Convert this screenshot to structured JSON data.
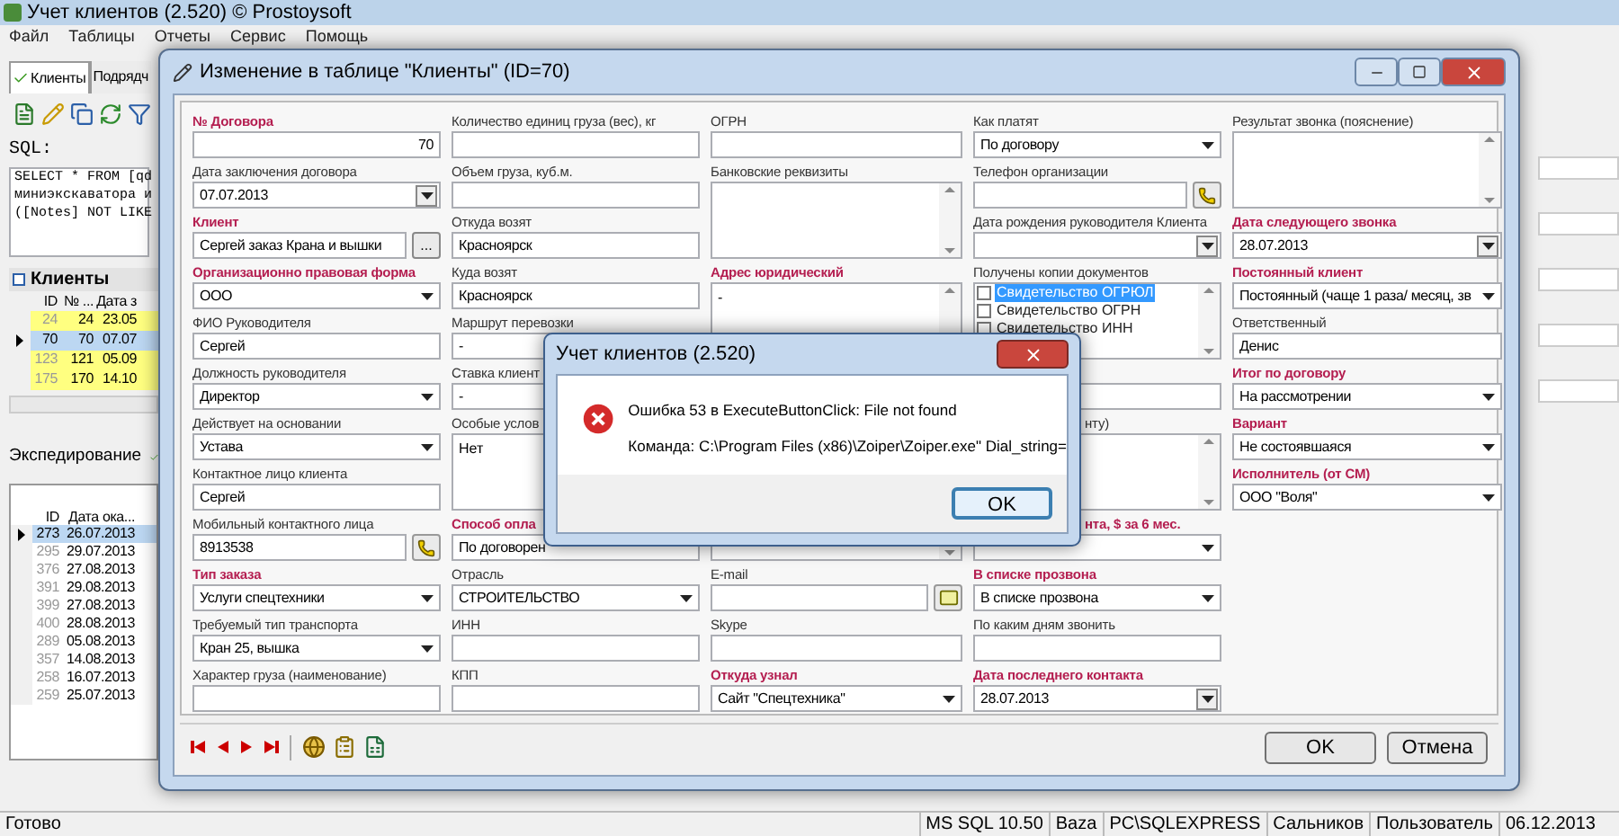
{
  "app": {
    "title": "Учет клиентов (2.520) © Prostoysoft",
    "menu": [
      "Файл",
      "Таблицы",
      "Отчеты",
      "Сервис",
      "Помощь"
    ],
    "tabs": [
      {
        "label": "Клиенты",
        "selected": true
      },
      {
        "label": "Подрядч",
        "selected": false
      }
    ],
    "sql_label": "SQL:",
    "sql_lines": [
      "SELECT * FROM [qd",
      "миниэкскаватора и",
      "([Notes] NOT LIKE"
    ],
    "clients": {
      "title": "Клиенты",
      "columns": [
        "ID",
        "№ ...",
        "Дата з"
      ],
      "rows": [
        {
          "cells": [
            "24",
            "24",
            "23.05"
          ],
          "selected": false,
          "highlighted": true
        },
        {
          "cells": [
            "70",
            "70",
            "07.07"
          ],
          "selected": true,
          "highlighted": false
        },
        {
          "cells": [
            "123",
            "121",
            "05.09"
          ],
          "selected": false,
          "highlighted": true
        },
        {
          "cells": [
            "175",
            "170",
            "14.10"
          ],
          "selected": false,
          "highlighted": true
        }
      ]
    },
    "expedition": {
      "title": "Экспедирование",
      "columns": [
        "ID",
        "Дата ока..."
      ],
      "rows": [
        {
          "cells": [
            "273",
            "26.07.2013"
          ],
          "selected": true
        },
        {
          "cells": [
            "295",
            "29.07.2013"
          ],
          "selected": false
        },
        {
          "cells": [
            "376",
            "27.08.2013"
          ],
          "selected": false
        },
        {
          "cells": [
            "391",
            "29.08.2013"
          ],
          "selected": false
        },
        {
          "cells": [
            "399",
            "27.08.2013"
          ],
          "selected": false
        },
        {
          "cells": [
            "400",
            "28.08.2013"
          ],
          "selected": false
        },
        {
          "cells": [
            "289",
            "05.08.2013"
          ],
          "selected": false
        },
        {
          "cells": [
            "357",
            "14.08.2013"
          ],
          "selected": false
        },
        {
          "cells": [
            "258",
            "16.07.2013"
          ],
          "selected": false
        },
        {
          "cells": [
            "259",
            "25.07.2013"
          ],
          "selected": false
        }
      ]
    }
  },
  "dialog": {
    "title": "Изменение в таблице \"Клиенты\" (ID=70)",
    "columns": [
      [
        {
          "label": "№ Договора",
          "required": true,
          "kind": "number",
          "value": "70"
        },
        {
          "label": "Дата заключения договора",
          "required": false,
          "kind": "date",
          "value": "07.07.2013"
        },
        {
          "label": "Клиент",
          "required": true,
          "kind": "browse",
          "value": "Сергей заказ Крана и вышки",
          "button_text": "..."
        },
        {
          "label": "Организационно правовая форма",
          "required": true,
          "kind": "select",
          "value": "ООО"
        },
        {
          "label": "ФИО Руководителя",
          "required": false,
          "kind": "text",
          "value": "Сергей"
        },
        {
          "label": "Должность руководителя",
          "required": false,
          "kind": "select",
          "value": "Директор"
        },
        {
          "label": "Действует на основании",
          "required": false,
          "kind": "select",
          "value": "Устава"
        },
        {
          "label": "Контактное лицо клиента",
          "required": false,
          "kind": "text",
          "value": "Сергей"
        },
        {
          "label": "Мобильный контактного лица",
          "required": false,
          "kind": "phone",
          "value": "8913538"
        },
        {
          "label": "Тип заказа",
          "required": true,
          "kind": "select",
          "value": "Услуги спецтехники"
        },
        {
          "label": "Требуемый тип транспорта",
          "required": false,
          "kind": "select",
          "value": "Кран 25, вышка"
        },
        {
          "label": "Характер груза (наименование)",
          "required": false,
          "kind": "text"
        }
      ],
      [
        {
          "label": "Количество единиц груза (вес), кг",
          "required": false,
          "kind": "text"
        },
        {
          "label": "Объем груза, куб.м.",
          "required": false,
          "kind": "text"
        },
        {
          "label": "Откуда возят",
          "required": false,
          "kind": "text",
          "value": "Красноярск"
        },
        {
          "label": "Куда возят",
          "required": false,
          "kind": "text",
          "value": "Красноярск"
        },
        {
          "label": "Маршрут перевозки",
          "required": false,
          "kind": "text",
          "value": "-"
        },
        {
          "label": "Ставка клиент",
          "required": false,
          "kind": "text",
          "value": "-"
        },
        {
          "label": "Особые услов",
          "required": false,
          "kind": "textarea",
          "value": "Нет"
        },
        {
          "label": "Способ опла",
          "required": true,
          "kind": "text",
          "value": "По договорен"
        },
        {
          "label": "Отрасль",
          "required": false,
          "kind": "select",
          "value": "СТРОИТЕЛЬСТВО"
        },
        {
          "label": "ИНН",
          "required": false,
          "kind": "text"
        },
        {
          "label": "КПП",
          "required": false,
          "kind": "text"
        }
      ],
      [
        {
          "label": "ОГРН",
          "required": false,
          "kind": "text"
        },
        {
          "label": "Банковские реквизиты",
          "required": false,
          "kind": "textarea"
        },
        {
          "label": "Адрес юридический",
          "required": true,
          "kind": "textarea",
          "value": "-"
        },
        {
          "kind": "large-textarea"
        },
        {
          "label": "E-mail",
          "required": false,
          "kind": "email"
        },
        {
          "label": "Skype",
          "required": false,
          "kind": "text"
        },
        {
          "label": "Откуда узнал",
          "required": true,
          "kind": "select",
          "value": "Сайт \"Спецтехника\""
        }
      ],
      [
        {
          "label": "Как платят",
          "required": false,
          "kind": "select",
          "value": "По договору"
        },
        {
          "label": "Телефон организации",
          "required": false,
          "kind": "phone"
        },
        {
          "label": "Дата рождения руководителя Клиента",
          "required": false,
          "kind": "date"
        },
        {
          "label": "Получены копии документов",
          "required": false,
          "kind": "listbox",
          "items": [
            {
              "label": "Свидетельство ОГРЮЛ",
              "checked": false,
              "selected": true
            },
            {
              "label": "Свидетельство ОГРН",
              "checked": false,
              "selected": false
            },
            {
              "label": "Свидетельство ИНН",
              "checked": false,
              "selected": false
            }
          ]
        },
        {
          "kind": "text"
        },
        {
          "label": "нту)",
          "required": false,
          "covered": true,
          "kind": "textarea"
        },
        {
          "label": "нта, $ за 6 мес.",
          "required": true,
          "covered": true,
          "kind": "select"
        },
        {
          "label": "В списке прозвона",
          "required": true,
          "kind": "select",
          "value": "В списке прозвона"
        },
        {
          "label": "По каким дням звонить",
          "required": false,
          "kind": "text"
        },
        {
          "label": "Дата последнего контакта",
          "required": true,
          "kind": "date",
          "value": "28.07.2013"
        }
      ],
      [
        {
          "label": "Результат звонка (пояснение)",
          "required": false,
          "kind": "textarea"
        },
        {
          "label": "Дата следующего звонка",
          "required": true,
          "kind": "date",
          "value": "28.07.2013"
        },
        {
          "label": "Постоянный клиент",
          "required": true,
          "kind": "select",
          "value": "Постоянный (чаще 1 раза/ месяц, зв"
        },
        {
          "label": "Ответственный",
          "required": false,
          "kind": "text",
          "value": "Денис"
        },
        {
          "label": "Итог по договору",
          "required": true,
          "kind": "select",
          "value": "На рассмотрении"
        },
        {
          "label": "Вариант",
          "required": true,
          "kind": "select",
          "value": "Не состоявшаяся"
        },
        {
          "label": "Исполнитель (от СМ)",
          "required": true,
          "kind": "select",
          "value": "ООО \"Воля\""
        }
      ]
    ],
    "ok": "OK",
    "cancel": "Отмена"
  },
  "message_box": {
    "title": "Учет клиентов (2.520)",
    "message": "Ошибка 53 в ExecuteButtonClick: File not found",
    "command": "Команда: C:\\Program Files (x86)\\Zoiper\\Zoiper.exe\" Dial_string=",
    "ok": "OK"
  },
  "status_bar": [
    "Готово",
    "MS SQL 10.50",
    "Baza",
    "PC\\SQLEXPRESS",
    "Сальников",
    "Пользователь",
    "06.12.2013"
  ]
}
